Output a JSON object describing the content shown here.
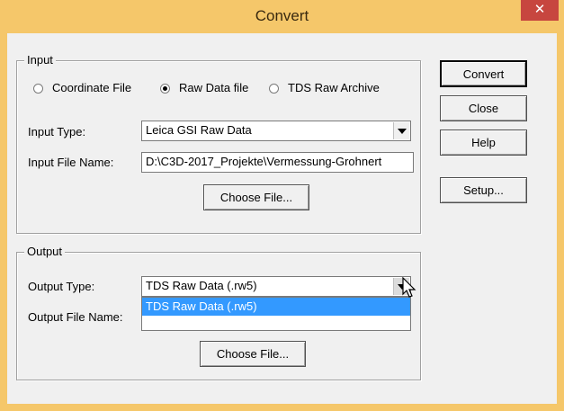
{
  "window": {
    "title": "Convert",
    "close_glyph": "✕"
  },
  "input_group": {
    "legend": "Input",
    "radios": [
      {
        "label": "Coordinate File",
        "checked": false
      },
      {
        "label": "Raw Data file",
        "checked": true
      },
      {
        "label": "TDS Raw Archive",
        "checked": false
      }
    ],
    "input_type_label": "Input Type:",
    "input_type_value": "Leica GSI Raw Data",
    "input_file_label": "Input File Name:",
    "input_file_value": "D:\\C3D-2017_Projekte\\Vermessung-Grohnert",
    "choose_file": "Choose File..."
  },
  "output_group": {
    "legend": "Output",
    "output_type_label": "Output Type:",
    "output_type_value": "TDS Raw Data (.rw5)",
    "dropdown_options": [
      "TDS Raw Data (.rw5)"
    ],
    "output_file_label": "Output File Name:",
    "output_file_value": "",
    "choose_file": "Choose File..."
  },
  "buttons": {
    "convert": "Convert",
    "close": "Close",
    "help": "Help",
    "setup": "Setup..."
  },
  "colors": {
    "titlebar": "#f5c76a",
    "close_button": "#c7463f",
    "selection": "#3399ff"
  },
  "icons": {
    "cursor": "mouse-pointer-icon"
  }
}
